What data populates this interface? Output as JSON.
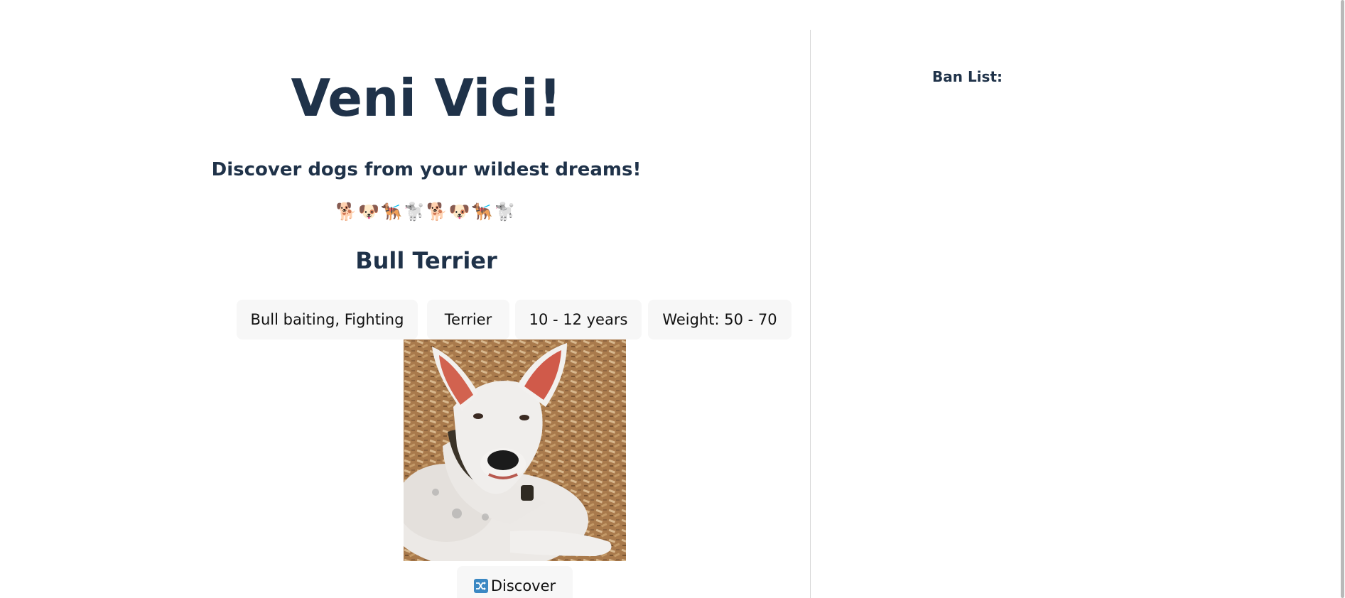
{
  "app": {
    "title": "Veni Vici!",
    "subtitle": "Discover dogs from your wildest dreams!",
    "emoji_strip": "🐕🐶🐕‍🦺🐩🐕🐶🐕‍🦺🐩"
  },
  "dog": {
    "breed_name": "Bull Terrier",
    "attributes": [
      {
        "label": "Bull baiting, Fighting",
        "kind": "bred_for"
      },
      {
        "label": "Terrier",
        "kind": "breed_group"
      },
      {
        "label": "10 - 12 years",
        "kind": "life_span"
      },
      {
        "label": "Weight: 50 - 70",
        "kind": "weight"
      }
    ],
    "image_subject": "white bull terrier lying on wood chips"
  },
  "actions": {
    "discover_label": "Discover",
    "discover_icon": "shuffle-icon"
  },
  "ban_list": {
    "title": "Ban List:",
    "items": []
  },
  "colors": {
    "heading": "#1f3249",
    "button_bg": "#f7f7f7",
    "divider": "#d6d6d6",
    "shuffle_icon": "#3b88c3"
  }
}
